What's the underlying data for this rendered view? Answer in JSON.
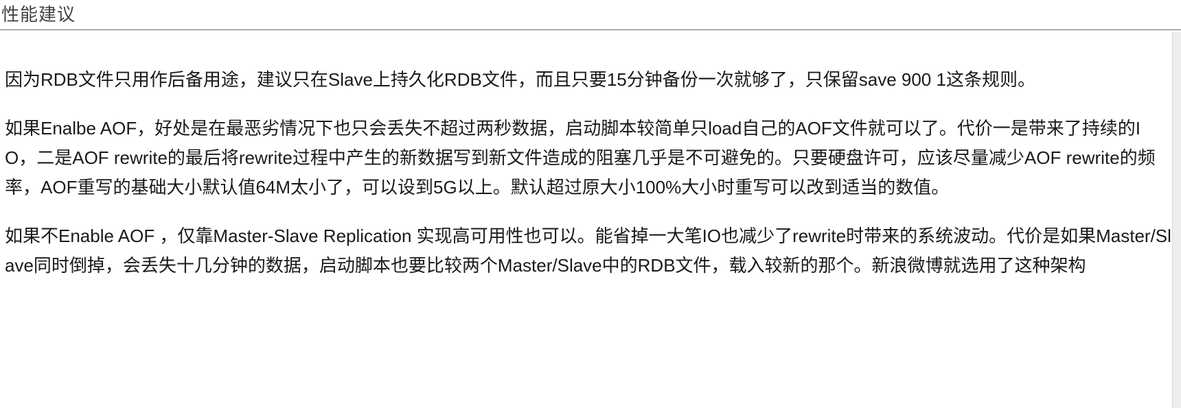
{
  "header": {
    "title": "性能建议"
  },
  "paragraphs": [
    "因为RDB文件只用作后备用途，建议只在Slave上持久化RDB文件，而且只要15分钟备份一次就够了，只保留save 900 1这条规则。",
    "如果Enalbe AOF，好处是在最恶劣情况下也只会丢失不超过两秒数据，启动脚本较简单只load自己的AOF文件就可以了。代价一是带来了持续的IO，二是AOF rewrite的最后将rewrite过程中产生的新数据写到新文件造成的阻塞几乎是不可避免的。只要硬盘许可，应该尽量减少AOF rewrite的频率，AOF重写的基础大小默认值64M太小了，可以设到5G以上。默认超过原大小100%大小时重写可以改到适当的数值。",
    "如果不Enable AOF ，仅靠Master-Slave Replication 实现高可用性也可以。能省掉一大笔IO也减少了rewrite时带来的系统波动。代价是如果Master/Slave同时倒掉，会丢失十几分钟的数据，启动脚本也要比较两个Master/Slave中的RDB文件，载入较新的那个。新浪微博就选用了这种架构"
  ]
}
